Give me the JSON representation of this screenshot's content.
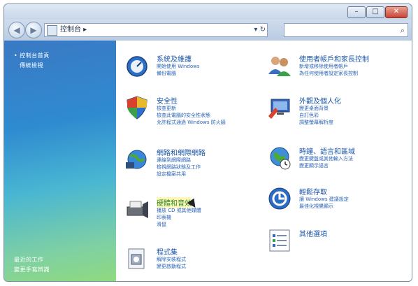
{
  "window": {
    "controls": {
      "minimize": "–",
      "maximize": "□",
      "close": "✕"
    }
  },
  "nav": {
    "back": "◀",
    "forward": "▶",
    "address": "控制台 ▸",
    "address_arrows": "▾ ↻",
    "search_placeholder": "",
    "search_icon": "search-icon"
  },
  "sidebar": {
    "top": [
      "控制台首頁",
      "傳統檢視"
    ],
    "bottom": [
      "最近的工作",
      "變更手寫辨識"
    ]
  },
  "categories": [
    {
      "title": "系統及維護",
      "links": [
        "開始使用 Windows",
        "備份電腦"
      ]
    },
    {
      "title": "使用者帳戶和家長控制",
      "links": [
        "新增或移除使用者帳戶",
        "為任何使用者設定家長控制"
      ]
    },
    {
      "title": "安全性",
      "links": [
        "檢查更新",
        "檢查此電腦的安全性狀態",
        "允許程式通過 Windows 防火牆"
      ]
    },
    {
      "title": "外觀及個人化",
      "links": [
        "變更桌面背景",
        "自訂色彩",
        "調整螢幕解析度"
      ]
    },
    {
      "title": "網路和網際網路",
      "links": [
        "連線到網際網路",
        "檢視網路狀態及工作",
        "設定檔案共用"
      ]
    },
    {
      "title": "時鐘、語言和區域",
      "links": [
        "變更鍵盤或其他輸入方法",
        "變更顯示語言"
      ]
    },
    {
      "title": "硬體和音效",
      "links": [
        "播放 CD 或其他媒體",
        "印表機",
        "滑鼠"
      ]
    },
    {
      "title": "輕鬆存取",
      "links": [
        "讓 Windows 建議設定",
        "最佳化視覺顯示"
      ]
    },
    {
      "title": "程式集",
      "links": [
        "解除安裝程式",
        "變更啟動程式"
      ]
    },
    {
      "title": "其他選項",
      "links": []
    }
  ]
}
